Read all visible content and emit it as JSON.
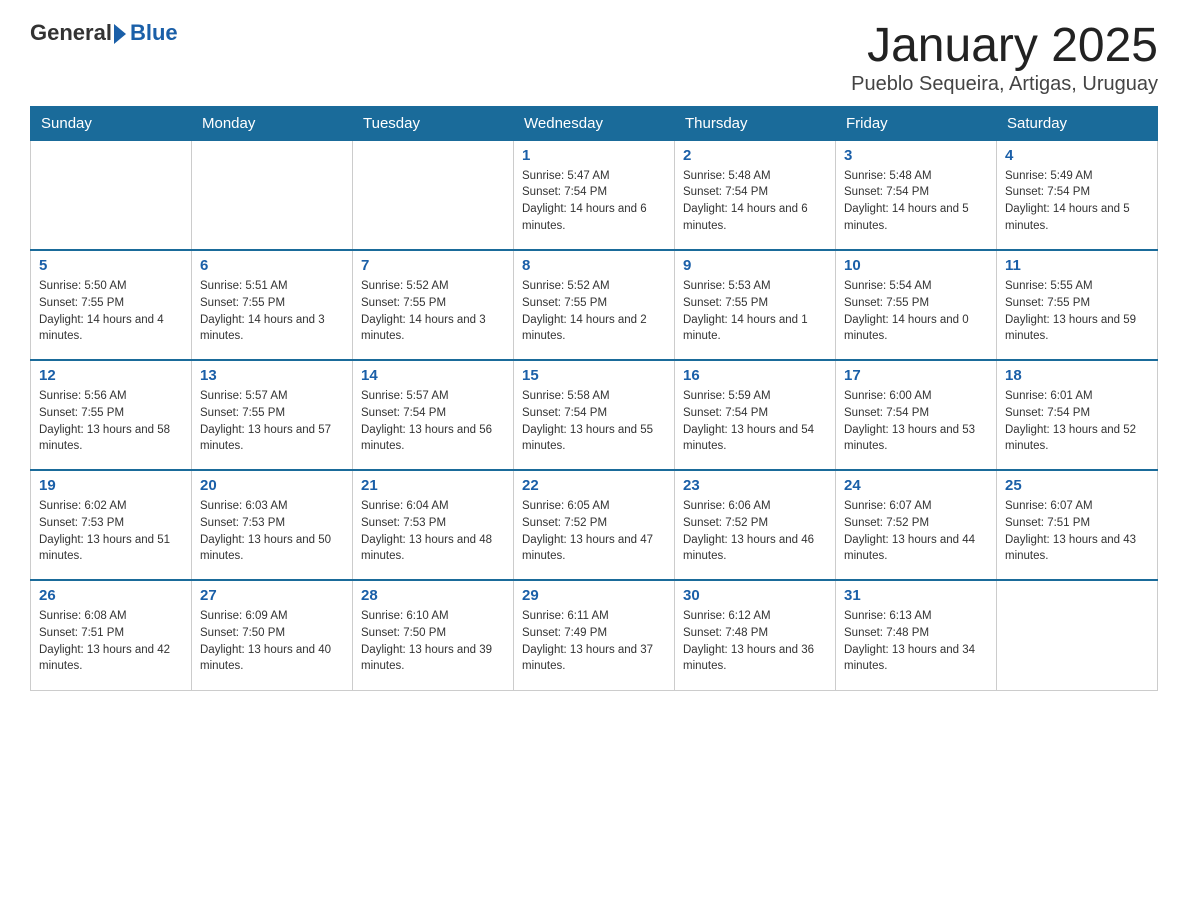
{
  "logo": {
    "general": "General",
    "blue": "Blue"
  },
  "title": "January 2025",
  "subtitle": "Pueblo Sequeira, Artigas, Uruguay",
  "days": [
    "Sunday",
    "Monday",
    "Tuesday",
    "Wednesday",
    "Thursday",
    "Friday",
    "Saturday"
  ],
  "weeks": [
    [
      {
        "day": "",
        "sunrise": "",
        "sunset": "",
        "daylight": ""
      },
      {
        "day": "",
        "sunrise": "",
        "sunset": "",
        "daylight": ""
      },
      {
        "day": "",
        "sunrise": "",
        "sunset": "",
        "daylight": ""
      },
      {
        "day": "1",
        "sunrise": "Sunrise: 5:47 AM",
        "sunset": "Sunset: 7:54 PM",
        "daylight": "Daylight: 14 hours and 6 minutes."
      },
      {
        "day": "2",
        "sunrise": "Sunrise: 5:48 AM",
        "sunset": "Sunset: 7:54 PM",
        "daylight": "Daylight: 14 hours and 6 minutes."
      },
      {
        "day": "3",
        "sunrise": "Sunrise: 5:48 AM",
        "sunset": "Sunset: 7:54 PM",
        "daylight": "Daylight: 14 hours and 5 minutes."
      },
      {
        "day": "4",
        "sunrise": "Sunrise: 5:49 AM",
        "sunset": "Sunset: 7:54 PM",
        "daylight": "Daylight: 14 hours and 5 minutes."
      }
    ],
    [
      {
        "day": "5",
        "sunrise": "Sunrise: 5:50 AM",
        "sunset": "Sunset: 7:55 PM",
        "daylight": "Daylight: 14 hours and 4 minutes."
      },
      {
        "day": "6",
        "sunrise": "Sunrise: 5:51 AM",
        "sunset": "Sunset: 7:55 PM",
        "daylight": "Daylight: 14 hours and 3 minutes."
      },
      {
        "day": "7",
        "sunrise": "Sunrise: 5:52 AM",
        "sunset": "Sunset: 7:55 PM",
        "daylight": "Daylight: 14 hours and 3 minutes."
      },
      {
        "day": "8",
        "sunrise": "Sunrise: 5:52 AM",
        "sunset": "Sunset: 7:55 PM",
        "daylight": "Daylight: 14 hours and 2 minutes."
      },
      {
        "day": "9",
        "sunrise": "Sunrise: 5:53 AM",
        "sunset": "Sunset: 7:55 PM",
        "daylight": "Daylight: 14 hours and 1 minute."
      },
      {
        "day": "10",
        "sunrise": "Sunrise: 5:54 AM",
        "sunset": "Sunset: 7:55 PM",
        "daylight": "Daylight: 14 hours and 0 minutes."
      },
      {
        "day": "11",
        "sunrise": "Sunrise: 5:55 AM",
        "sunset": "Sunset: 7:55 PM",
        "daylight": "Daylight: 13 hours and 59 minutes."
      }
    ],
    [
      {
        "day": "12",
        "sunrise": "Sunrise: 5:56 AM",
        "sunset": "Sunset: 7:55 PM",
        "daylight": "Daylight: 13 hours and 58 minutes."
      },
      {
        "day": "13",
        "sunrise": "Sunrise: 5:57 AM",
        "sunset": "Sunset: 7:55 PM",
        "daylight": "Daylight: 13 hours and 57 minutes."
      },
      {
        "day": "14",
        "sunrise": "Sunrise: 5:57 AM",
        "sunset": "Sunset: 7:54 PM",
        "daylight": "Daylight: 13 hours and 56 minutes."
      },
      {
        "day": "15",
        "sunrise": "Sunrise: 5:58 AM",
        "sunset": "Sunset: 7:54 PM",
        "daylight": "Daylight: 13 hours and 55 minutes."
      },
      {
        "day": "16",
        "sunrise": "Sunrise: 5:59 AM",
        "sunset": "Sunset: 7:54 PM",
        "daylight": "Daylight: 13 hours and 54 minutes."
      },
      {
        "day": "17",
        "sunrise": "Sunrise: 6:00 AM",
        "sunset": "Sunset: 7:54 PM",
        "daylight": "Daylight: 13 hours and 53 minutes."
      },
      {
        "day": "18",
        "sunrise": "Sunrise: 6:01 AM",
        "sunset": "Sunset: 7:54 PM",
        "daylight": "Daylight: 13 hours and 52 minutes."
      }
    ],
    [
      {
        "day": "19",
        "sunrise": "Sunrise: 6:02 AM",
        "sunset": "Sunset: 7:53 PM",
        "daylight": "Daylight: 13 hours and 51 minutes."
      },
      {
        "day": "20",
        "sunrise": "Sunrise: 6:03 AM",
        "sunset": "Sunset: 7:53 PM",
        "daylight": "Daylight: 13 hours and 50 minutes."
      },
      {
        "day": "21",
        "sunrise": "Sunrise: 6:04 AM",
        "sunset": "Sunset: 7:53 PM",
        "daylight": "Daylight: 13 hours and 48 minutes."
      },
      {
        "day": "22",
        "sunrise": "Sunrise: 6:05 AM",
        "sunset": "Sunset: 7:52 PM",
        "daylight": "Daylight: 13 hours and 47 minutes."
      },
      {
        "day": "23",
        "sunrise": "Sunrise: 6:06 AM",
        "sunset": "Sunset: 7:52 PM",
        "daylight": "Daylight: 13 hours and 46 minutes."
      },
      {
        "day": "24",
        "sunrise": "Sunrise: 6:07 AM",
        "sunset": "Sunset: 7:52 PM",
        "daylight": "Daylight: 13 hours and 44 minutes."
      },
      {
        "day": "25",
        "sunrise": "Sunrise: 6:07 AM",
        "sunset": "Sunset: 7:51 PM",
        "daylight": "Daylight: 13 hours and 43 minutes."
      }
    ],
    [
      {
        "day": "26",
        "sunrise": "Sunrise: 6:08 AM",
        "sunset": "Sunset: 7:51 PM",
        "daylight": "Daylight: 13 hours and 42 minutes."
      },
      {
        "day": "27",
        "sunrise": "Sunrise: 6:09 AM",
        "sunset": "Sunset: 7:50 PM",
        "daylight": "Daylight: 13 hours and 40 minutes."
      },
      {
        "day": "28",
        "sunrise": "Sunrise: 6:10 AM",
        "sunset": "Sunset: 7:50 PM",
        "daylight": "Daylight: 13 hours and 39 minutes."
      },
      {
        "day": "29",
        "sunrise": "Sunrise: 6:11 AM",
        "sunset": "Sunset: 7:49 PM",
        "daylight": "Daylight: 13 hours and 37 minutes."
      },
      {
        "day": "30",
        "sunrise": "Sunrise: 6:12 AM",
        "sunset": "Sunset: 7:48 PM",
        "daylight": "Daylight: 13 hours and 36 minutes."
      },
      {
        "day": "31",
        "sunrise": "Sunrise: 6:13 AM",
        "sunset": "Sunset: 7:48 PM",
        "daylight": "Daylight: 13 hours and 34 minutes."
      },
      {
        "day": "",
        "sunrise": "",
        "sunset": "",
        "daylight": ""
      }
    ]
  ]
}
